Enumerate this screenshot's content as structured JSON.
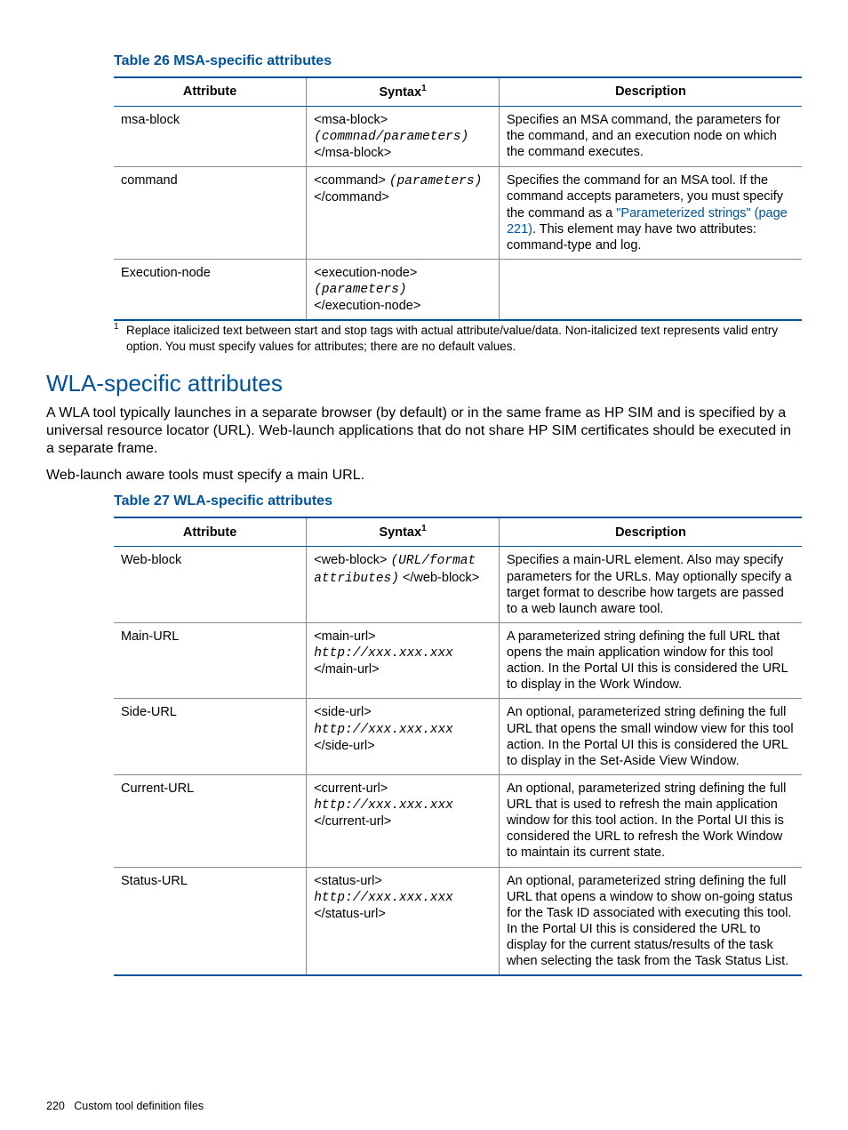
{
  "headers": {
    "attribute": "Attribute",
    "syntax": "Syntax",
    "description": "Description",
    "syntax_fn": "1"
  },
  "table26": {
    "title": "Table 26 MSA-specific attributes",
    "rows": [
      {
        "attr": "msa-block",
        "syn_open": "<msa-block>",
        "syn_body": "(commnad/parameters)",
        "syn_close": "</msa-block>",
        "desc_plain": "Specifies an MSA command, the parameters for the command, and an execution node on which the command executes."
      },
      {
        "attr": "command",
        "syn_open": "<command>",
        "syn_body": "(parameters)",
        "syn_close": "</command>",
        "desc_before": "Specifies the command for an MSA tool. If the command accepts parameters, you must specify the command as a ",
        "desc_link": "\"Parameterized strings\" (page 221)",
        "desc_after": ". This element may have two attributes: command-type and log."
      },
      {
        "attr": "Execution-node",
        "syn_open": "<execution-node>",
        "syn_body": "(parameters)",
        "syn_close": "</execution-node>",
        "desc_plain": ""
      }
    ],
    "footnote": {
      "num": "1",
      "text": "Replace italicized text between start and stop tags with actual attribute/value/data. Non-italicized text represents valid entry option. You must specify values for attributes; there are no default values."
    }
  },
  "wla_section": {
    "title": "WLA-specific attributes",
    "p1": "A WLA tool typically launches in a separate browser (by default) or in the same frame as HP SIM and is specified by a universal resource locator (URL). Web-launch applications that do not share HP SIM certificates should be executed in a separate frame.",
    "p2": "Web-launch aware tools must specify a main URL."
  },
  "table27": {
    "title": "Table 27 WLA-specific attributes",
    "rows": [
      {
        "attr": "Web-block",
        "syn_open": "<web-block>",
        "syn_body": "(URL/format attributes)",
        "syn_close": " </web-block>",
        "desc": "Specifies a main-URL element. Also may specify parameters for the URLs. May optionally specify a target format to describe how targets are passed to a web launch aware tool."
      },
      {
        "attr": "Main-URL",
        "syn_open": "<main-url>",
        "syn_body": "http://xxx.xxx.xxx",
        "syn_close": "</main-url>",
        "desc": "A parameterized string defining the full URL that opens the main application window for this tool action. In the Portal UI this is considered the URL to display in the Work Window."
      },
      {
        "attr": "Side-URL",
        "syn_open": "<side-url>",
        "syn_body": "http://xxx.xxx.xxx",
        "syn_close": "</side-url>",
        "desc": "An optional, parameterized string defining the full URL that opens the small window view for this tool action. In the Portal UI this is considered the URL to display in the Set-Aside View Window."
      },
      {
        "attr": "Current-URL",
        "syn_open": "<current-url>",
        "syn_body": "http://xxx.xxx.xxx",
        "syn_close": "</current-url>",
        "desc": "An optional, parameterized string defining the full URL that is used to refresh the main application window for this tool action. In the Portal UI this is considered the URL to refresh the Work Window to maintain its current state."
      },
      {
        "attr": "Status-URL",
        "syn_open": "<status-url>",
        "syn_body": "http://xxx.xxx.xxx",
        "syn_close": "</status-url>",
        "desc": "An optional, parameterized string defining the full URL that opens a window to show on-going status for the Task ID associated with executing this tool. In the Portal UI this is considered the URL to display for the current status/results of the task when selecting the task from the Task Status List."
      }
    ]
  },
  "footer": {
    "page": "220",
    "label": "Custom tool definition files"
  }
}
